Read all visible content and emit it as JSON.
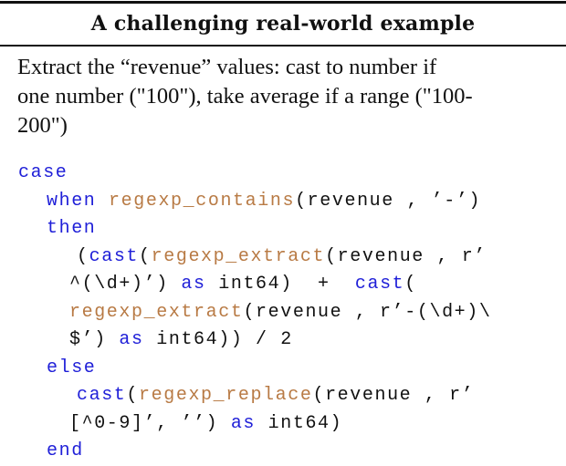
{
  "table": {
    "title": "A challenging real-world example",
    "description": "Extract the “revenue” values: cast to number if one number (\"100\"), take average if a range (\"100-200\")",
    "description_lines": [
      "Extract the “revenue” values: cast to number if",
      "one number (\"100\"), take average if a range (\"100-",
      "200\")"
    ]
  },
  "colors": {
    "keyword": "#1f1fd8",
    "function": "#b87a44",
    "text": "#111111"
  },
  "code": {
    "language": "sql",
    "lines": [
      {
        "indent": 20,
        "tokens": [
          {
            "t": "case",
            "c": "kw"
          }
        ]
      },
      {
        "indent": 51,
        "tokens": [
          {
            "t": "when",
            "c": "kw"
          },
          {
            "t": " ",
            "c": "tx"
          },
          {
            "t": "regexp_contains",
            "c": "fn"
          },
          {
            "t": "(revenue , ’-’)",
            "c": "tx"
          }
        ]
      },
      {
        "indent": 51,
        "tokens": [
          {
            "t": "then",
            "c": "kw"
          }
        ]
      },
      {
        "indent": 84,
        "tokens": [
          {
            "t": "(",
            "c": "tx"
          },
          {
            "t": "cast",
            "c": "kw"
          },
          {
            "t": "(",
            "c": "tx"
          },
          {
            "t": "regexp_extract",
            "c": "fn"
          },
          {
            "t": "(revenue , r’",
            "c": "tx"
          }
        ]
      },
      {
        "indent": 76,
        "tokens": [
          {
            "t": "^(\\d+)’) ",
            "c": "tx"
          },
          {
            "t": "as",
            "c": "kw"
          },
          {
            "t": " int64)  +  ",
            "c": "tx"
          },
          {
            "t": "cast",
            "c": "kw"
          },
          {
            "t": "(",
            "c": "tx"
          }
        ]
      },
      {
        "indent": 76,
        "tokens": [
          {
            "t": "regexp_extract",
            "c": "fn"
          },
          {
            "t": "(revenue , r’-(\\d+)\\",
            "c": "tx"
          }
        ]
      },
      {
        "indent": 76,
        "tokens": [
          {
            "t": "$’) ",
            "c": "tx"
          },
          {
            "t": "as",
            "c": "kw"
          },
          {
            "t": " int64)) / 2",
            "c": "tx"
          }
        ]
      },
      {
        "indent": 51,
        "tokens": [
          {
            "t": "else",
            "c": "kw"
          }
        ]
      },
      {
        "indent": 84,
        "tokens": [
          {
            "t": "cast",
            "c": "kw"
          },
          {
            "t": "(",
            "c": "tx"
          },
          {
            "t": "regexp_replace",
            "c": "fn"
          },
          {
            "t": "(revenue , r’",
            "c": "tx"
          }
        ]
      },
      {
        "indent": 76,
        "tokens": [
          {
            "t": "[^0-9]’, ’’) ",
            "c": "tx"
          },
          {
            "t": "as",
            "c": "kw"
          },
          {
            "t": " int64)",
            "c": "tx"
          }
        ]
      },
      {
        "indent": 51,
        "tokens": [
          {
            "t": "end",
            "c": "kw"
          }
        ]
      }
    ]
  }
}
